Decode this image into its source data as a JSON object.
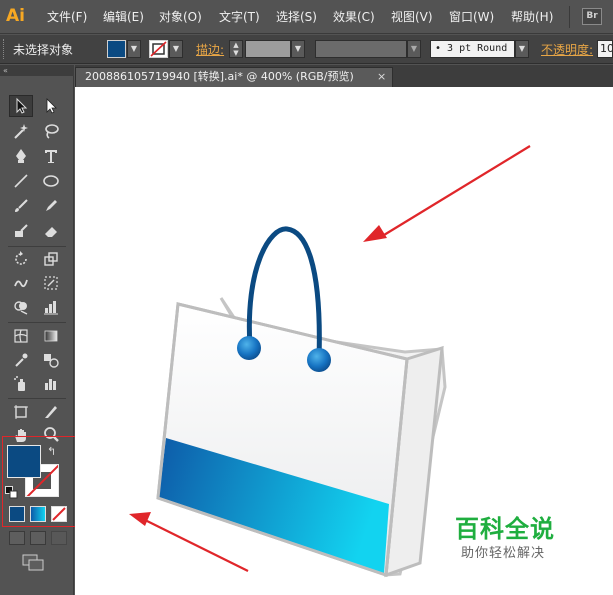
{
  "app": {
    "logo": "Ai"
  },
  "menu": [
    "文件(F)",
    "编辑(E)",
    "对象(O)",
    "文字(T)",
    "选择(S)",
    "效果(C)",
    "视图(V)",
    "窗口(W)",
    "帮助(H)"
  ],
  "bridge_badge": "Br",
  "control_bar": {
    "selection_status": "未选择对象",
    "stroke_label": "描边:",
    "brush_value": "• 3 pt Round",
    "opacity_label": "不透明度:",
    "opacity_value": "10"
  },
  "document_tab": {
    "title": "200886105719940  [转换].ai* @ 400% (RGB/预览)",
    "close": "×"
  },
  "colors": {
    "fill": "#0b4a82",
    "stroke": "#ffffff",
    "accent": "#f7a823",
    "highlight": "#e0262a",
    "bag_handle": "#0b4a82",
    "bag_gradient_start": "#0e5aa8",
    "bag_gradient_end": "#12d3f0"
  },
  "watermark": {
    "title": "百科全说",
    "subtitle": "助你轻松解决"
  },
  "icons": {
    "tools": [
      "selection-tool-icon",
      "direct-selection-tool-icon",
      "magic-wand-icon",
      "lasso-icon",
      "pen-tool-icon",
      "type-tool-icon",
      "line-tool-icon",
      "ellipse-tool-icon",
      "paintbrush-icon",
      "pencil-icon",
      "blob-brush-icon",
      "eraser-icon",
      "rotate-tool-icon",
      "scale-tool-icon",
      "warp-tool-icon",
      "free-transform-icon",
      "shape-builder-icon",
      "graph-tool-icon",
      "mesh-tool-icon",
      "gradient-tool-icon",
      "eyedropper-icon",
      "blend-tool-icon",
      "symbol-sprayer-icon",
      "column-graph-icon",
      "artboard-tool-icon",
      "slice-tool-icon",
      "hand-tool-icon",
      "zoom-tool-icon"
    ]
  }
}
